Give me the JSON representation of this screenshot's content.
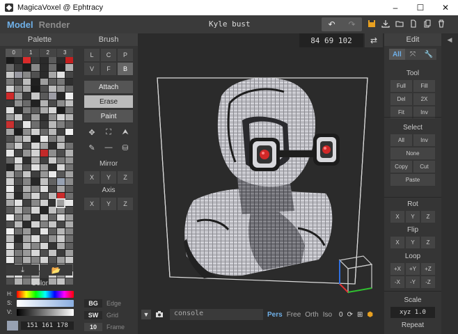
{
  "window": {
    "title": "MagicaVoxel @ Ephtracy",
    "min": "–",
    "max": "☐",
    "close": "✕"
  },
  "menubar": {
    "model_tab": "Model",
    "render_tab": "Render",
    "file_title": "Kyle bust",
    "undo": "↶",
    "redo": "↷"
  },
  "file_icons": [
    "save-icon",
    "export-icon",
    "open-folder-icon",
    "new-file-icon",
    "copy-file-icon",
    "delete-icon"
  ],
  "coords": {
    "value": "84 69 102",
    "swap": "⇄"
  },
  "palette": {
    "header": "Palette",
    "tabs": [
      "0",
      "1",
      "2",
      "3"
    ],
    "selected_index": 143,
    "actions": {
      "save": "⤓",
      "open": "📂"
    },
    "colors": [
      "#1a1a1a",
      "#2a2a2a",
      "#d92b2b",
      "#3a3a3a",
      "#2a2a2a",
      "#5a5a5a",
      "#2b2b2b",
      "#c41f1f",
      "#6a6a6a",
      "#3c3c3c",
      "#1d1d1d",
      "#8a8a8a",
      "#2b2b2b",
      "#6c6c6c",
      "#1f1f1f",
      "#b0b0b0",
      "#c9c9c9",
      "#9a9aa2",
      "#888",
      "#505050",
      "#2a2a2a",
      "#a7a7a7",
      "#e2e2e2",
      "#464646",
      "#7a7a7a",
      "#4a4a4a",
      "#bcbcbc",
      "#202020",
      "#9e9e9e",
      "#5b5b5b",
      "#777",
      "#2e2e2e",
      "#d2d2d2",
      "#7d7d7d",
      "#aaaaaa",
      "#1b1b1b",
      "#4e4e4e",
      "#bdbdbd",
      "#999",
      "#666",
      "#cf2a2a",
      "#999",
      "#3b3b3b",
      "#c7c7c7",
      "#5a5a5a",
      "#9c9ca4",
      "#262626",
      "#efefef",
      "#3a3a3a",
      "#909090",
      "#6a6a6a",
      "#222",
      "#b3b3b3",
      "#4b4b4b",
      "#8c8c8c",
      "#c0c0c0",
      "#e0e0e0",
      "#2c2c2c",
      "#7c7c7c",
      "#5c5c5c",
      "#ababab",
      "#d6d6d6",
      "#1c1c1c",
      "#767676",
      "#969696",
      "#cdcdcd",
      "#474747",
      "#a1a1a1",
      "#2f2f2f",
      "#8f8f8f",
      "#d8d8d8",
      "#b6b6b6",
      "#c93030",
      "#3d3d3d",
      "#e6e6e6",
      "#6e6e6e",
      "#393939",
      "#b9b9b9",
      "#7f7f7f",
      "#5e5e5e",
      "#a4a4a4",
      "#1e1e1e",
      "#8d8d8d",
      "#d0d0d0",
      "#696969",
      "#b8b8b8",
      "#3e3e3e",
      "#f0f0f0",
      "#4f4f4f",
      "#9b9b9b",
      "#c4c4c4",
      "#242424",
      "#e8e8e8",
      "#797979",
      "#a9a9a9",
      "#353535",
      "#868686",
      "#cccccc",
      "#515151",
      "#d7d7d7",
      "#a0a0a0",
      "#2d2d2d",
      "#bfbfbf",
      "#717171",
      "#e4e4e4",
      "#424242",
      "#949494",
      "#d3d3d3",
      "#c22a2a",
      "#8e8e8e",
      "#4d4d4d",
      "#b2b2b2",
      "#656565",
      "#dcdcdc",
      "#2e2e2e",
      "#aeaeae",
      "#414141",
      "#cbcbcb",
      "#7b7b7b",
      "#969696",
      "#232323",
      "#bbbbbb",
      "#575757",
      "#e1e1e1",
      "#9d9d9d",
      "#303030",
      "#d9d9d9",
      "#747474",
      "#b4b4b4",
      "#6b6b6b",
      "#c6c6c6",
      "#3f3f3f",
      "#979797",
      "#e9e9e9",
      "#585858",
      "#a3a3a3",
      "#d1d1d1",
      "#4c4c4c",
      "#858585",
      "#272727",
      "#c3c3c3",
      "#626262",
      "#97a1b2",
      "#8b8b8b",
      "#ececec",
      "#363636",
      "#b1b1b1",
      "#828282",
      "#dedede",
      "#464646",
      "#a6a6a6",
      "#5f5f5f",
      "#c8c8c8",
      "#2a2a2a",
      "#939393",
      "#d4d4d4",
      "#545454",
      "#bdbdbd",
      "#cc2b2b",
      "#6f6f6f",
      "#a8a8a8",
      "#e3e3e3",
      "#404040",
      "#888888",
      "#cecece",
      "#333333",
      "#9f9f9f",
      "#e7e7e7",
      "#595959",
      "#b5b5b5",
      "#737373",
      "#d5d5d5",
      "#252525",
      "#c1c1c1",
      "#8a8a8a",
      "#4a4a4a",
      "#eeeeee",
      "#7e7e7e",
      "#a2a2a2",
      "#373737",
      "#cacaca",
      "#646464",
      "#dddddd",
      "#9a9a9a",
      "#525252",
      "#bababa",
      "#2b2b2b",
      "#d2d2d2",
      "#818181",
      "#c5c5c5",
      "#474747",
      "#adadad",
      "#f2f2f2",
      "#6d6d6d",
      "#989898",
      "#3c3c3c",
      "#e5e5e5",
      "#5d5d5d",
      "#b7b7b7",
      "#848484",
      "#c0c0c0",
      "#292929",
      "#a5a5a5",
      "#dbdbdb",
      "#565656",
      "#919191",
      "#cdcdcd",
      "#707070",
      "#e2e2e2",
      "#444444",
      "#bcbcbc",
      "#878787",
      "#d6d6d6",
      "#343434",
      "#acacac",
      "#606060",
      "#cfcfcf",
      "#7a7a7a",
      "#999999",
      "#d8d8d8",
      "#4e4e4e",
      "#c2c2c2",
      "#3b3b3b",
      "#9e9e9e",
      "#eaeaea",
      "#676767",
      "#b0b0b0",
      "#858585",
      "#d3d3d3",
      "#535353",
      "#a0a0a0",
      "#c9c9c9",
      "#313131",
      "#bebebe",
      "#767676",
      "#dadada",
      "#8c8c8c",
      "#454545",
      "#c7c7c7",
      "#5b5b5b",
      "#b9b9b9",
      "#dfdfdf",
      "#686868",
      "#a7a7a7",
      "#3a3a3a",
      "#cccccc",
      "#909090",
      "#e0e0e0",
      "#505050",
      "#b3b3b3",
      "#7c7c7c",
      "#d0d0d0",
      "#2c2c2c",
      "#aaaaaa",
      "#c4c4c4",
      "#636363"
    ]
  },
  "color": {
    "label": "Color",
    "h": "H:",
    "s": "S:",
    "v": "V:",
    "rgb": "151  161  178",
    "swatch": "#97a1b2"
  },
  "brush": {
    "header": "Brush",
    "shapes": [
      "L",
      "C",
      "P",
      "V",
      "F",
      "B"
    ],
    "modes": [
      "Attach",
      "Erase",
      "Paint"
    ],
    "tools": [
      "✥",
      "⛶",
      "⮝",
      "✎",
      "—",
      "⛁"
    ],
    "mirror_label": "Mirror",
    "axis_label": "Axis",
    "xyz": [
      "X",
      "Y",
      "Z"
    ],
    "bg": "BG",
    "edge": "Edge",
    "sw": "SW",
    "grid": "Grid",
    "frame_num": "10",
    "frame": "Frame"
  },
  "console": {
    "expand": "▼",
    "camera": "📷",
    "placeholder": "console",
    "projections": [
      "Pers",
      "Free",
      "Orth",
      "Iso"
    ],
    "counter": "0"
  },
  "edit": {
    "header": "Edit",
    "tabs": [
      "All",
      "⤧",
      "🔧"
    ],
    "tool_label": "Tool",
    "tool_buttons": [
      "Full",
      "Fill",
      "Del",
      "2X",
      "Fit",
      "Inv"
    ],
    "select_label": "Select",
    "select_buttons": [
      "All",
      "Inv"
    ],
    "none": "None",
    "copy": "Copy",
    "cut": "Cut",
    "paste": "Paste",
    "rot_label": "Rot",
    "flip_label": "Flip",
    "xyz": [
      "X",
      "Y",
      "Z"
    ],
    "loop_label": "Loop",
    "loop_buttons": [
      "+X",
      "+Y",
      "+Z",
      "-X",
      "-Y",
      "-Z"
    ],
    "scale_label": "Scale",
    "scale_value": "xyz 1.0",
    "repeat_label": "Repeat"
  },
  "accent": "#6fb0e8"
}
